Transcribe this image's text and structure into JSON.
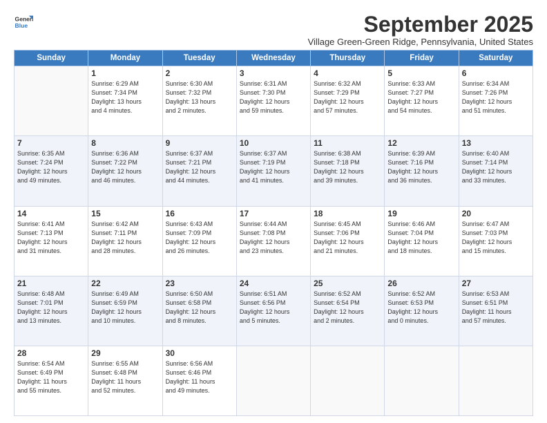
{
  "header": {
    "logo_general": "General",
    "logo_blue": "Blue",
    "month": "September 2025",
    "location": "Village Green-Green Ridge, Pennsylvania, United States"
  },
  "weekdays": [
    "Sunday",
    "Monday",
    "Tuesday",
    "Wednesday",
    "Thursday",
    "Friday",
    "Saturday"
  ],
  "weeks": [
    [
      {
        "day": "",
        "info": ""
      },
      {
        "day": "1",
        "info": "Sunrise: 6:29 AM\nSunset: 7:34 PM\nDaylight: 13 hours\nand 4 minutes."
      },
      {
        "day": "2",
        "info": "Sunrise: 6:30 AM\nSunset: 7:32 PM\nDaylight: 13 hours\nand 2 minutes."
      },
      {
        "day": "3",
        "info": "Sunrise: 6:31 AM\nSunset: 7:30 PM\nDaylight: 12 hours\nand 59 minutes."
      },
      {
        "day": "4",
        "info": "Sunrise: 6:32 AM\nSunset: 7:29 PM\nDaylight: 12 hours\nand 57 minutes."
      },
      {
        "day": "5",
        "info": "Sunrise: 6:33 AM\nSunset: 7:27 PM\nDaylight: 12 hours\nand 54 minutes."
      },
      {
        "day": "6",
        "info": "Sunrise: 6:34 AM\nSunset: 7:26 PM\nDaylight: 12 hours\nand 51 minutes."
      }
    ],
    [
      {
        "day": "7",
        "info": "Sunrise: 6:35 AM\nSunset: 7:24 PM\nDaylight: 12 hours\nand 49 minutes."
      },
      {
        "day": "8",
        "info": "Sunrise: 6:36 AM\nSunset: 7:22 PM\nDaylight: 12 hours\nand 46 minutes."
      },
      {
        "day": "9",
        "info": "Sunrise: 6:37 AM\nSunset: 7:21 PM\nDaylight: 12 hours\nand 44 minutes."
      },
      {
        "day": "10",
        "info": "Sunrise: 6:37 AM\nSunset: 7:19 PM\nDaylight: 12 hours\nand 41 minutes."
      },
      {
        "day": "11",
        "info": "Sunrise: 6:38 AM\nSunset: 7:18 PM\nDaylight: 12 hours\nand 39 minutes."
      },
      {
        "day": "12",
        "info": "Sunrise: 6:39 AM\nSunset: 7:16 PM\nDaylight: 12 hours\nand 36 minutes."
      },
      {
        "day": "13",
        "info": "Sunrise: 6:40 AM\nSunset: 7:14 PM\nDaylight: 12 hours\nand 33 minutes."
      }
    ],
    [
      {
        "day": "14",
        "info": "Sunrise: 6:41 AM\nSunset: 7:13 PM\nDaylight: 12 hours\nand 31 minutes."
      },
      {
        "day": "15",
        "info": "Sunrise: 6:42 AM\nSunset: 7:11 PM\nDaylight: 12 hours\nand 28 minutes."
      },
      {
        "day": "16",
        "info": "Sunrise: 6:43 AM\nSunset: 7:09 PM\nDaylight: 12 hours\nand 26 minutes."
      },
      {
        "day": "17",
        "info": "Sunrise: 6:44 AM\nSunset: 7:08 PM\nDaylight: 12 hours\nand 23 minutes."
      },
      {
        "day": "18",
        "info": "Sunrise: 6:45 AM\nSunset: 7:06 PM\nDaylight: 12 hours\nand 21 minutes."
      },
      {
        "day": "19",
        "info": "Sunrise: 6:46 AM\nSunset: 7:04 PM\nDaylight: 12 hours\nand 18 minutes."
      },
      {
        "day": "20",
        "info": "Sunrise: 6:47 AM\nSunset: 7:03 PM\nDaylight: 12 hours\nand 15 minutes."
      }
    ],
    [
      {
        "day": "21",
        "info": "Sunrise: 6:48 AM\nSunset: 7:01 PM\nDaylight: 12 hours\nand 13 minutes."
      },
      {
        "day": "22",
        "info": "Sunrise: 6:49 AM\nSunset: 6:59 PM\nDaylight: 12 hours\nand 10 minutes."
      },
      {
        "day": "23",
        "info": "Sunrise: 6:50 AM\nSunset: 6:58 PM\nDaylight: 12 hours\nand 8 minutes."
      },
      {
        "day": "24",
        "info": "Sunrise: 6:51 AM\nSunset: 6:56 PM\nDaylight: 12 hours\nand 5 minutes."
      },
      {
        "day": "25",
        "info": "Sunrise: 6:52 AM\nSunset: 6:54 PM\nDaylight: 12 hours\nand 2 minutes."
      },
      {
        "day": "26",
        "info": "Sunrise: 6:52 AM\nSunset: 6:53 PM\nDaylight: 12 hours\nand 0 minutes."
      },
      {
        "day": "27",
        "info": "Sunrise: 6:53 AM\nSunset: 6:51 PM\nDaylight: 11 hours\nand 57 minutes."
      }
    ],
    [
      {
        "day": "28",
        "info": "Sunrise: 6:54 AM\nSunset: 6:49 PM\nDaylight: 11 hours\nand 55 minutes."
      },
      {
        "day": "29",
        "info": "Sunrise: 6:55 AM\nSunset: 6:48 PM\nDaylight: 11 hours\nand 52 minutes."
      },
      {
        "day": "30",
        "info": "Sunrise: 6:56 AM\nSunset: 6:46 PM\nDaylight: 11 hours\nand 49 minutes."
      },
      {
        "day": "",
        "info": ""
      },
      {
        "day": "",
        "info": ""
      },
      {
        "day": "",
        "info": ""
      },
      {
        "day": "",
        "info": ""
      }
    ]
  ]
}
